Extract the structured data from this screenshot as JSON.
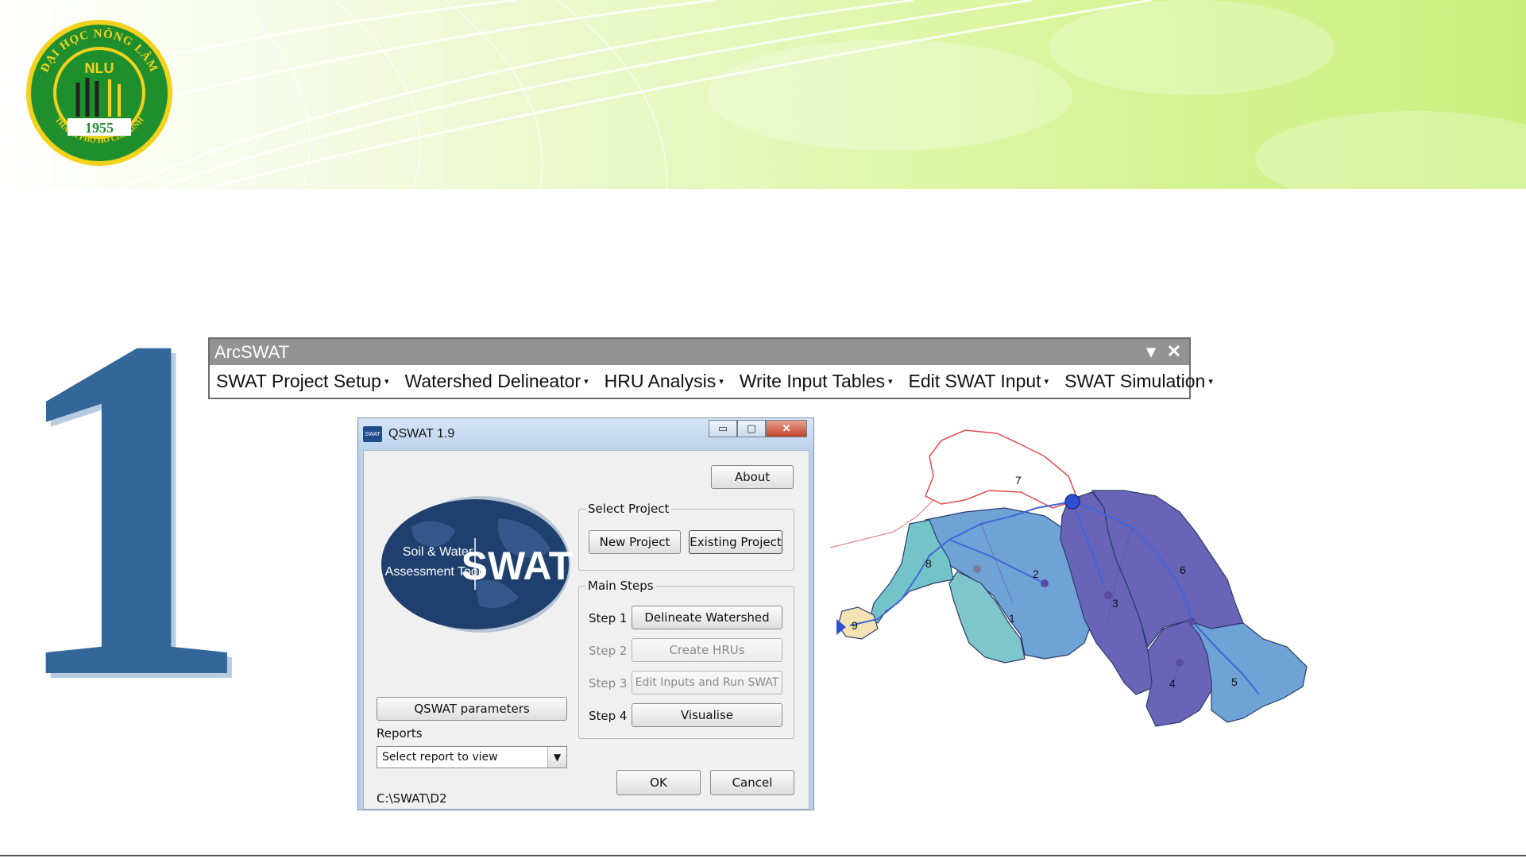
{
  "banner": {
    "logo": {
      "ring_text": "ĐẠI HỌC NÔNG LÂM",
      "ring_text_bottom": "THÀNH PHỐ HỒ CHÍ MINH",
      "abbr": "NLU",
      "year": "1955",
      "colors": {
        "green": "#1f8f2e",
        "yellow": "#f2d21b"
      }
    }
  },
  "slide": {
    "number": "1",
    "number_color": "#336699"
  },
  "arcswat": {
    "title": "ArcSWAT",
    "title_controls": {
      "dropdown": "▾",
      "close": "✕"
    },
    "menu": [
      {
        "label": "SWAT Project Setup"
      },
      {
        "label": "Watershed Delineator"
      },
      {
        "label": "HRU Analysis"
      },
      {
        "label": "Write Input Tables"
      },
      {
        "label": "Edit SWAT Input"
      },
      {
        "label": "SWAT Simulation"
      }
    ],
    "caret": "▾"
  },
  "qswat": {
    "title": "QSWAT 1.9",
    "icon_text": "SWAT",
    "controls": {
      "minimize": "▭",
      "maximize": "▢",
      "close": "✕"
    },
    "about_label": "About",
    "swat_logo": {
      "line1": "Soil & Water",
      "line2": "Assessment Tool",
      "brand": "SWAT"
    },
    "select_project": {
      "label": "Select Project",
      "new_label": "New Project",
      "existing_label": "Existing Project"
    },
    "main_steps": {
      "label": "Main Steps",
      "steps": [
        {
          "step": "Step 1",
          "button": "Delineate Watershed",
          "enabled": true
        },
        {
          "step": "Step 2",
          "button": "Create HRUs",
          "enabled": false
        },
        {
          "step": "Step 3",
          "button": "Edit Inputs and Run SWAT",
          "enabled": false
        },
        {
          "step": "Step 4",
          "button": "Visualise",
          "enabled": true
        }
      ]
    },
    "params_label": "QSWAT parameters",
    "reports_label": "Reports",
    "reports_select": "Select report to view",
    "ok_label": "OK",
    "cancel_label": "Cancel",
    "path": "C:\\SWAT\\D2"
  },
  "map": {
    "subbasins": [
      "1",
      "2",
      "3",
      "4",
      "5",
      "6",
      "7",
      "8",
      "9"
    ],
    "colors": {
      "dark": "#6a64b8",
      "light": "#6fa3d6",
      "teal": "#72c4c9",
      "stream": "#3f66d9",
      "boundary": "#e14b4b"
    }
  }
}
